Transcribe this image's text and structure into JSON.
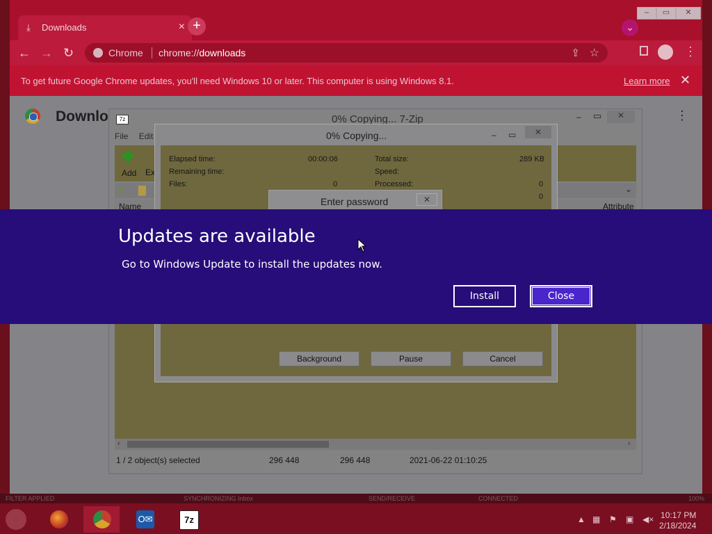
{
  "browser": {
    "tab_title": "Downloads",
    "tab_close": "×",
    "new_tab": "+",
    "omnibox_chip": "Chrome",
    "url_prefix": "chrome://",
    "url_path": "downloads",
    "infobar_message": "To get future Google Chrome updates, you'll need Windows 10 or later. This computer is using Windows 8.1.",
    "infobar_link": "Learn more",
    "infobar_close": "✕",
    "page_heading": "Downlo",
    "window_controls": [
      "–",
      "▭",
      "✕"
    ]
  },
  "zip_window": {
    "title": "0% Copying... 7-Zip",
    "icon_text": "7z",
    "menu": [
      "File",
      "Edit"
    ],
    "add_label": "Add",
    "extract_label": "Ext",
    "column_name": "Name",
    "column_attributes": "Attribute",
    "status": {
      "selection": "1 / 2 object(s) selected",
      "size1": "296 448",
      "size2": "296 448",
      "modified": "2021-06-22 01:10:25"
    }
  },
  "copy_dialog": {
    "title": "0% Copying...",
    "elapsed_label": "Elapsed time:",
    "elapsed_value": "00:00:06",
    "remaining_label": "Remaining time:",
    "files_label": "Files:",
    "files_value": "0",
    "total_size_label": "Total size:",
    "total_size_value": "289 KB",
    "speed_label": "Speed:",
    "processed_label": "Processed:",
    "processed_value": "0",
    "extra_value": "0",
    "buttons": [
      "Background",
      "Pause",
      "Cancel"
    ]
  },
  "password_dialog": {
    "title": "Enter password",
    "close": "✕"
  },
  "update_banner": {
    "heading": "Updates are available",
    "message": "Go to Windows Update to install the updates now.",
    "install_label": "Install",
    "close_label": "Close"
  },
  "background_strip": {
    "left": "FILTER APPLIED",
    "sync": "SYNCHRONIZING   Inbox",
    "send": "SEND/RECEIVE",
    "conn": "CONNECTED",
    "zoom": "100%"
  },
  "taskbar": {
    "time": "10:17 PM",
    "date": "2/18/2024",
    "apps": [
      "firefox-icon",
      "chrome-icon",
      "outlook-icon",
      "7zip-icon"
    ]
  }
}
